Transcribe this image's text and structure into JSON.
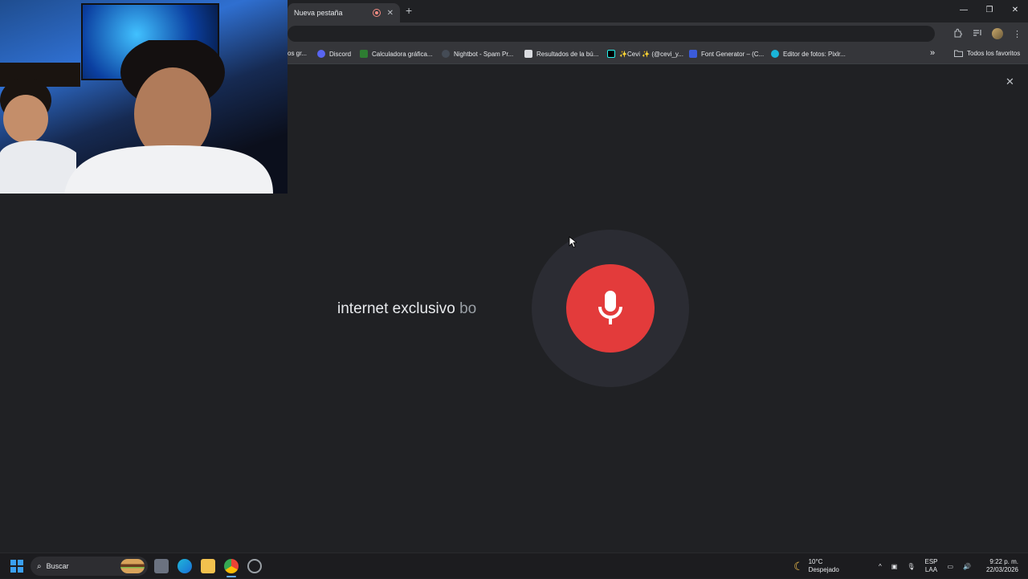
{
  "browser": {
    "tab_title": "Nueva pestaña",
    "tab_close": "✕",
    "new_tab": "+",
    "window_controls": [
      "—",
      "❐",
      "✕"
    ],
    "bookmarks": [
      {
        "label": "os gr...",
        "color": "#5f6368"
      },
      {
        "label": "Discord",
        "color": "#5865f2"
      },
      {
        "label": "Calculadora gráfica...",
        "color": "#2e7d32"
      },
      {
        "label": "Nightbot - Spam Pr...",
        "color": "#444b55"
      },
      {
        "label": "Resultados de la bú...",
        "color": "#dadce0"
      },
      {
        "label": "Cevi ✨ (@cevi_y...",
        "prefix": "✨",
        "color": "#000000"
      },
      {
        "label": "Font Generator – (C...",
        "color": "#3b5bdb"
      },
      {
        "label": "Editor de fotos: Pixlr...",
        "color": "#19b5d9"
      }
    ],
    "overflow_chevron": "»",
    "all_bookmarks": "Todos los favoritos"
  },
  "voice_search": {
    "transcript_final": "internet exclusivo",
    "transcript_interim": "bo",
    "close": "✕"
  },
  "taskbar": {
    "search_label": "Buscar",
    "weather_temp": "10°C",
    "weather_desc": "Despejado",
    "lang_top": "ESP",
    "lang_bottom": "LAA",
    "time": "9:22 p. m.",
    "date": "22/03/2026"
  },
  "colors": {
    "mic_red": "#e33b3b",
    "background": "#202124",
    "halo": "#2b2c33"
  }
}
